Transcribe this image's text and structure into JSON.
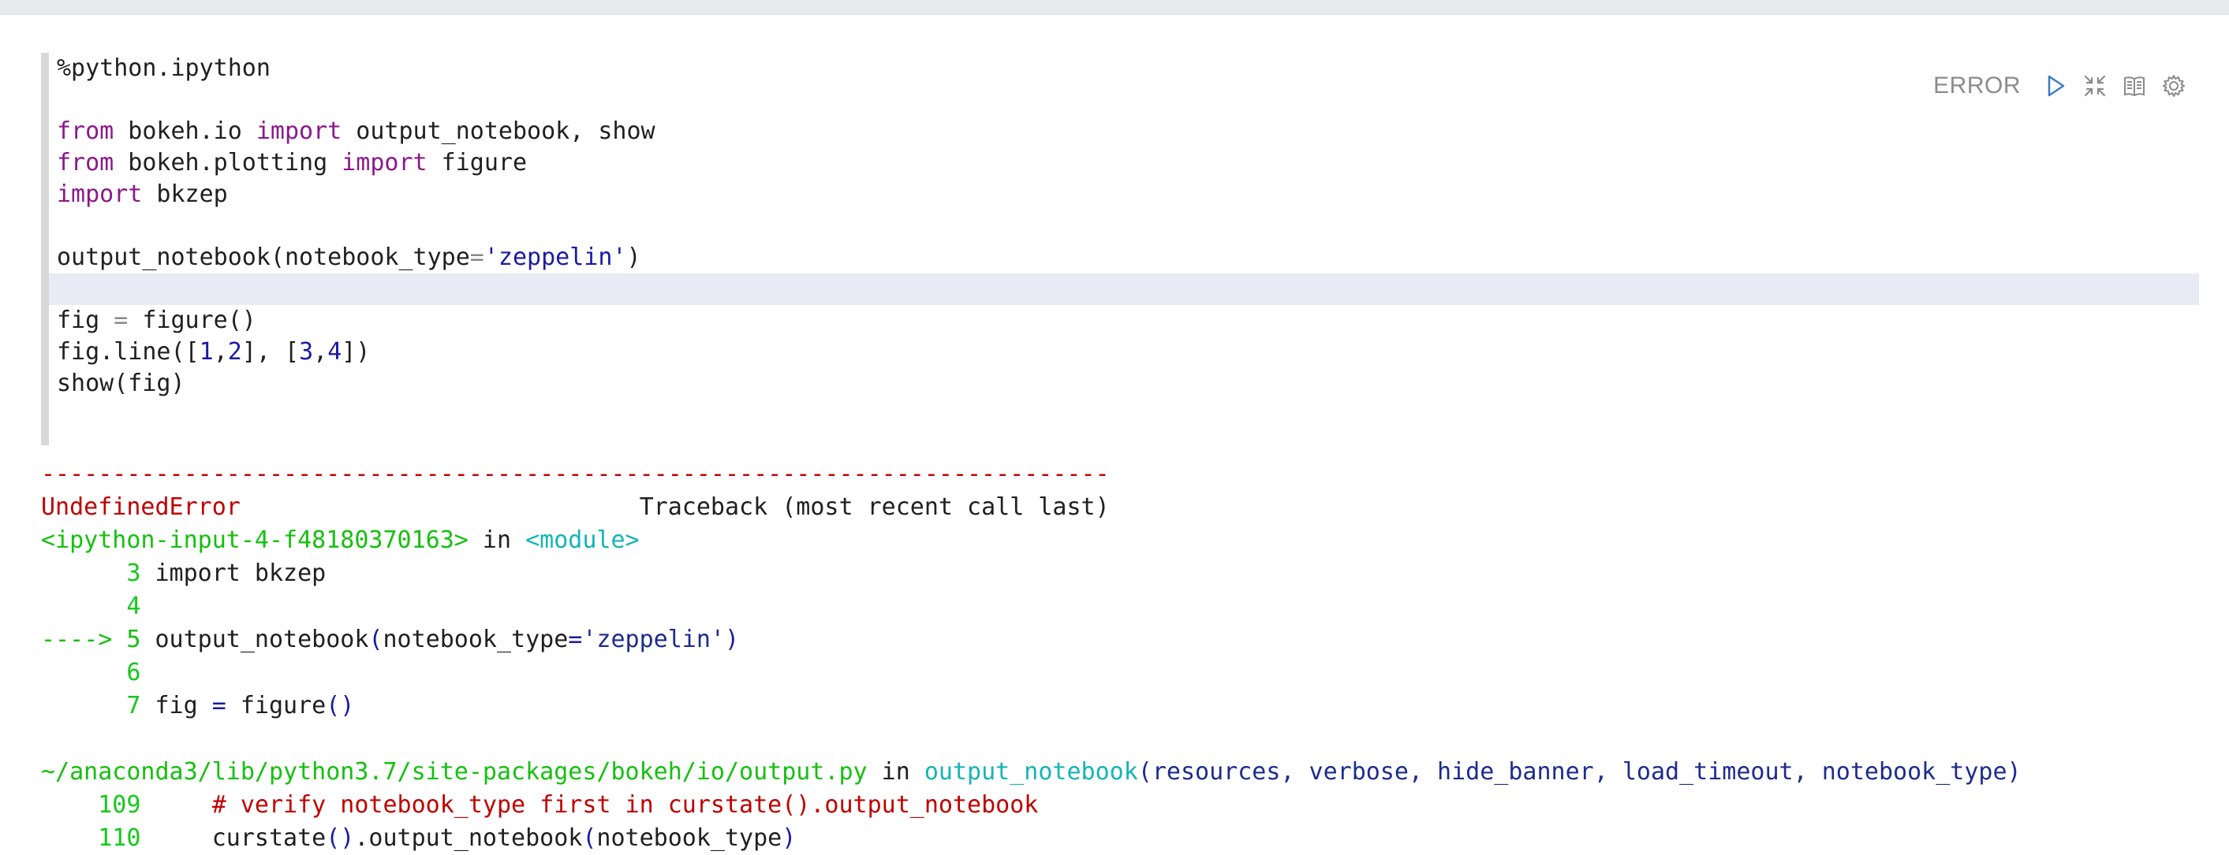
{
  "editor": {
    "lines": [
      {
        "t": [
          {
            "c": "%python.ipython"
          }
        ]
      },
      {
        "t": []
      },
      {
        "t": [
          {
            "c": "from",
            "k": "kw"
          },
          {
            "c": " bokeh.io "
          },
          {
            "c": "import",
            "k": "kw"
          },
          {
            "c": " output_notebook, show"
          }
        ]
      },
      {
        "t": [
          {
            "c": "from",
            "k": "kw"
          },
          {
            "c": " bokeh.plotting "
          },
          {
            "c": "import",
            "k": "kw"
          },
          {
            "c": " figure"
          }
        ]
      },
      {
        "t": [
          {
            "c": "import",
            "k": "kw"
          },
          {
            "c": " bkzep"
          }
        ]
      },
      {
        "t": []
      },
      {
        "t": [
          {
            "c": "output_notebook(notebook_type"
          },
          {
            "c": "=",
            "k": "op"
          },
          {
            "c": "'zeppelin'",
            "k": "str"
          },
          {
            "c": ")"
          }
        ]
      },
      {
        "t": [],
        "active": true
      },
      {
        "t": [
          {
            "c": "fig "
          },
          {
            "c": "=",
            "k": "op"
          },
          {
            "c": " figure()"
          }
        ]
      },
      {
        "t": [
          {
            "c": "fig.line(["
          },
          {
            "c": "1",
            "k": "num"
          },
          {
            "c": ","
          },
          {
            "c": "2",
            "k": "num"
          },
          {
            "c": "], ["
          },
          {
            "c": "3",
            "k": "num"
          },
          {
            "c": ","
          },
          {
            "c": "4",
            "k": "num"
          },
          {
            "c": "])"
          }
        ]
      },
      {
        "t": [
          {
            "c": "show(fig)"
          }
        ]
      },
      {
        "t": []
      }
    ]
  },
  "toolbar": {
    "status": "ERROR",
    "icons": [
      "run-icon",
      "collapse-icon",
      "book-icon",
      "settings-icon"
    ]
  },
  "output": {
    "lines": [
      [
        {
          "c": "---------------------------------------------------------------------------",
          "k": "red"
        }
      ],
      [
        {
          "c": "UndefinedError",
          "k": "red"
        },
        {
          "c": "                            Traceback (most recent call last)",
          "k": "black"
        }
      ],
      [
        {
          "c": "<ipython-input-4-f48180370163>",
          "k": "green"
        },
        {
          "c": " in ",
          "k": "black"
        },
        {
          "c": "<module>",
          "k": "cyan"
        }
      ],
      [
        {
          "c": "      3",
          "k": "lgreen"
        },
        {
          "c": " import bkzep",
          "k": "black"
        }
      ],
      [
        {
          "c": "      4",
          "k": "lgreen"
        }
      ],
      [
        {
          "c": "----> 5",
          "k": "green"
        },
        {
          "c": " output_notebook",
          "k": "black"
        },
        {
          "c": "(",
          "k": "blue"
        },
        {
          "c": "notebook_type",
          "k": "black"
        },
        {
          "c": "=",
          "k": "blue"
        },
        {
          "c": "'zeppelin'",
          "k": "navy"
        },
        {
          "c": ")",
          "k": "blue"
        }
      ],
      [
        {
          "c": "      6",
          "k": "lgreen"
        }
      ],
      [
        {
          "c": "      7",
          "k": "lgreen"
        },
        {
          "c": " fig ",
          "k": "black"
        },
        {
          "c": "=",
          "k": "blue"
        },
        {
          "c": " figure",
          "k": "black"
        },
        {
          "c": "()",
          "k": "blue"
        }
      ],
      [],
      [
        {
          "c": "~/anaconda3/lib/python3.7/site-packages/bokeh/io/output.py",
          "k": "green"
        },
        {
          "c": " in ",
          "k": "black"
        },
        {
          "c": "output_notebook",
          "k": "cyan"
        },
        {
          "c": "(resources, verbose, hide_banner, load_timeout, notebook_type)",
          "k": "navy"
        }
      ],
      [
        {
          "c": "    109",
          "k": "lgreen"
        },
        {
          "c": "     # verify notebook_type first in curstate().output_notebook",
          "k": "red"
        }
      ],
      [
        {
          "c": "    110",
          "k": "lgreen"
        },
        {
          "c": "     curstate",
          "k": "black"
        },
        {
          "c": "()",
          "k": "blue"
        },
        {
          "c": ".output_notebook",
          "k": "black"
        },
        {
          "c": "(",
          "k": "blue"
        },
        {
          "c": "notebook_type",
          "k": "black"
        },
        {
          "c": ")",
          "k": "blue"
        }
      ]
    ]
  }
}
